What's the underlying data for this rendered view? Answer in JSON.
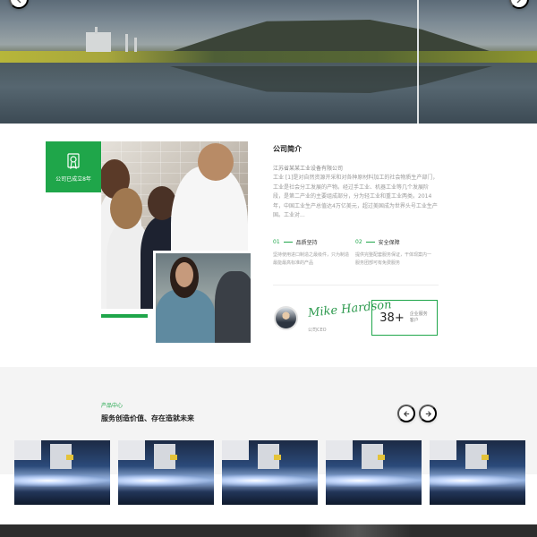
{
  "hero": {
    "prev_label": "previous slide",
    "next_label": "next slide"
  },
  "about": {
    "badge": "公司已成立8年",
    "title": "公司简介",
    "company": "江苏省某某工业设备有限公司",
    "body": "工业 [1]是对自然资源开采和对各种原材料加工的社会物质生产部门，工业是社会分工发展的产物。经过手工业、机器工业等几个发展阶段，是第二产业的主要组成部分，分为轻工业和重工业两类。2014年，中国工业生产总值达4万亿美元，超过美国成为世界头号工业生产国。工业对...",
    "points": [
      {
        "num": "01",
        "label": "品质坚持",
        "desc": "坚持使用进口制造之最级件，只为制造最能最高标准的产品"
      },
      {
        "num": "02",
        "label": "安全保障",
        "desc": "提供完整配套服务保证，干体现案内一服务团部可有免费服务"
      }
    ],
    "signature": "Mike Hardson",
    "ceo_label": "公司CEO",
    "stat_number": "38+",
    "stat_label": "企业服务客户"
  },
  "products": {
    "subtitle": "产品中心",
    "title": "服务创造价值、存在造就未来",
    "items": [
      "product-1",
      "product-2",
      "product-3",
      "product-4",
      "product-5"
    ]
  },
  "colors": {
    "accent": "#1fa64a",
    "text_dark": "#222222",
    "text_muted": "#9a9a9a"
  },
  "icons": {
    "badge": "award-certificate-icon",
    "prev": "arrow-left-icon",
    "next": "arrow-right-icon"
  }
}
